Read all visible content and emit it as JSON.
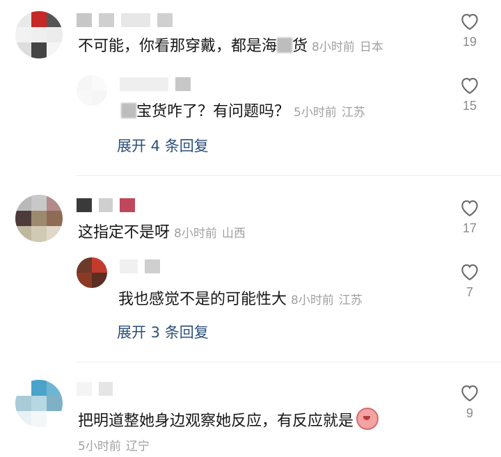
{
  "comments": [
    {
      "text_main": "不可能，你看那穿戴，都是海",
      "text_tail": "货",
      "time": "8小时前",
      "location": "日本",
      "likes": "19"
    },
    {
      "text_main": "宝货咋了？有问题吗？",
      "time": "5小时前",
      "location": "江苏",
      "likes": "15"
    },
    {
      "expand_label": "展开 4 条回复"
    },
    {
      "text_main": "这指定不是呀",
      "time": "8小时前",
      "location": "山西",
      "likes": "17"
    },
    {
      "text_main": "我也感觉不是的可能性大",
      "time": "8小时前",
      "location": "江苏",
      "likes": "7"
    },
    {
      "expand_label": "展开 3 条回复"
    },
    {
      "text_main": "把明道整她身边观察她反应，有反应就是",
      "time": "5小时前",
      "location": "辽宁",
      "likes": "9"
    }
  ],
  "icons": {
    "like": "heart-outline-icon",
    "emoji": "blush-face-emoji"
  }
}
